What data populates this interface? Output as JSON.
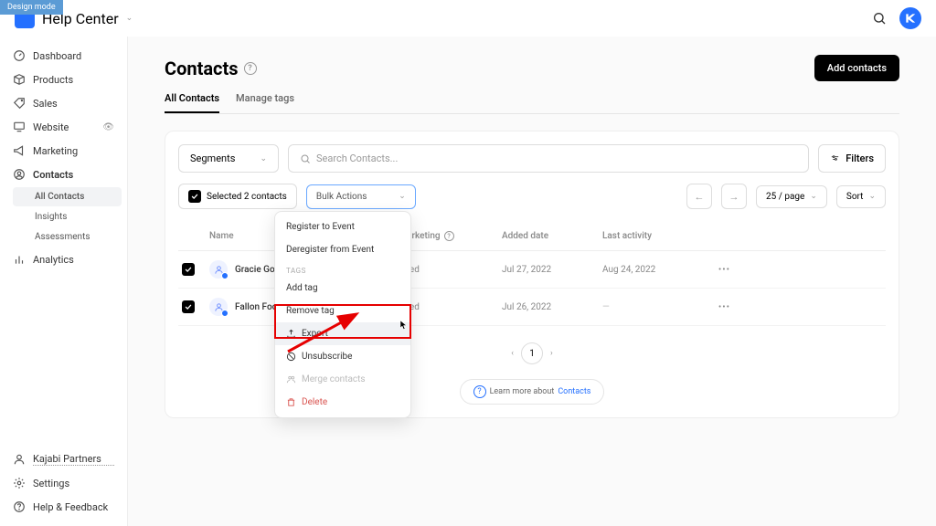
{
  "design_badge": "Design mode",
  "workspace": "Help Center",
  "sidebar": {
    "items": [
      {
        "label": "Dashboard",
        "icon": "dashboard"
      },
      {
        "label": "Products",
        "icon": "box"
      },
      {
        "label": "Sales",
        "icon": "tag"
      },
      {
        "label": "Website",
        "icon": "monitor",
        "eye": true
      },
      {
        "label": "Marketing",
        "icon": "megaphone"
      },
      {
        "label": "Contacts",
        "icon": "user-circle",
        "bold": true
      },
      {
        "label": "Analytics",
        "icon": "bars"
      }
    ],
    "contacts_sub": [
      {
        "label": "All Contacts",
        "active": true
      },
      {
        "label": "Insights"
      },
      {
        "label": "Assessments"
      }
    ],
    "footer": [
      {
        "label": "Kajabi Partners",
        "icon": "user",
        "dotted": true
      },
      {
        "label": "Settings",
        "icon": "gear"
      },
      {
        "label": "Help & Feedback",
        "icon": "help"
      }
    ]
  },
  "page": {
    "title": "Contacts",
    "add_button": "Add contacts",
    "tabs": [
      {
        "label": "All Contacts",
        "active": true
      },
      {
        "label": "Manage tags"
      }
    ]
  },
  "toolbar": {
    "segments": "Segments",
    "search_placeholder": "Search Contacts...",
    "filters": "Filters"
  },
  "action": {
    "selected_text": "Selected 2 contacts",
    "bulk_label": "Bulk Actions",
    "per_page": "25 / page",
    "sort": "Sort"
  },
  "dropdown": {
    "items": [
      {
        "label": "Register to Event"
      },
      {
        "label": "Deregister from Event"
      }
    ],
    "tags_header": "TAGS",
    "tag_items": [
      {
        "label": "Add tag"
      },
      {
        "label": "Remove tag"
      }
    ],
    "export": "Export",
    "unsubscribe": "Unsubscribe",
    "merge": "Merge contacts",
    "delete": "Delete"
  },
  "table": {
    "headers": {
      "name": "Name",
      "email_marketing": "Email Marketing",
      "added": "Added date",
      "activity": "Last activity"
    },
    "rows": [
      {
        "name": "Gracie Gourmet",
        "status": "Subscribed",
        "added": "Jul 27, 2022",
        "activity": "Aug 24, 2022"
      },
      {
        "name": "Fallon Foodie",
        "status": "Subscribed",
        "added": "Jul 26, 2022",
        "activity": "—"
      }
    ]
  },
  "pagination": {
    "page": "1"
  },
  "learn": {
    "prefix": "Learn more about ",
    "link": "Contacts"
  }
}
